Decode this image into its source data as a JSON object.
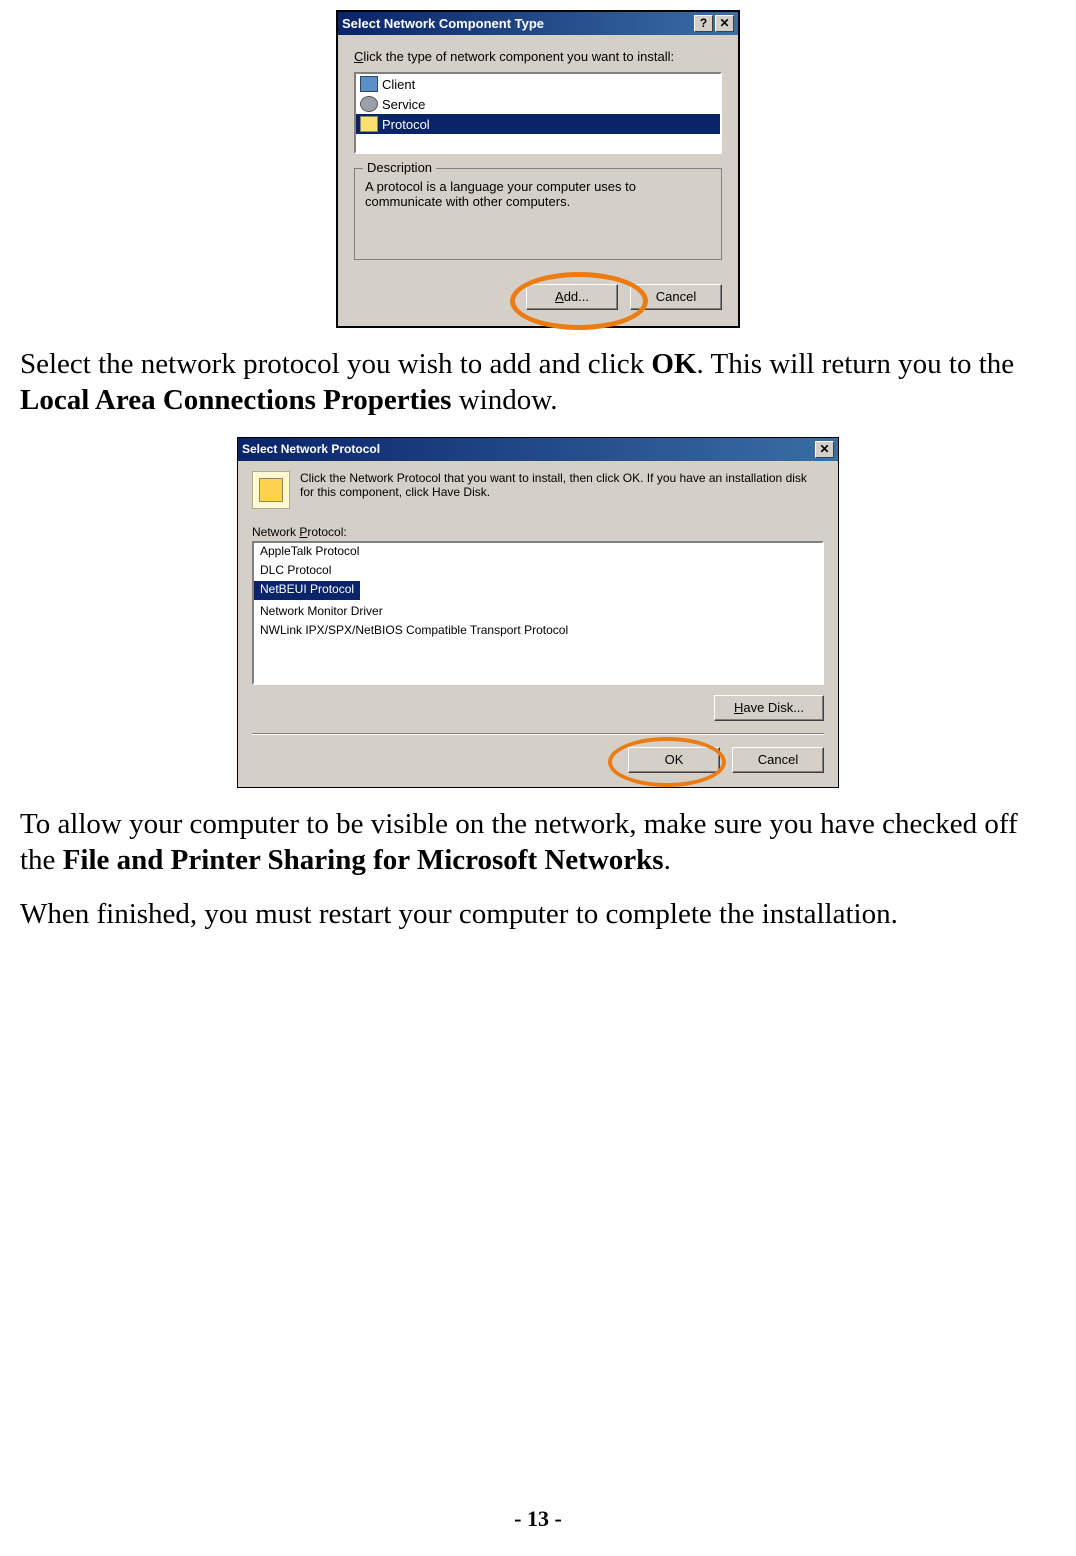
{
  "dialog1": {
    "title": "Select Network Component Type",
    "prompt_pre": "C",
    "prompt_post": "lick the type of network component you want to install:",
    "items": [
      "Client",
      "Service",
      "Protocol"
    ],
    "selected_index": 2,
    "group_label": "Description",
    "description": "A protocol is a language your computer uses to communicate with other computers.",
    "add_label_u": "A",
    "add_label_rest": "dd...",
    "cancel_label": "Cancel",
    "help_btn": "?",
    "close_btn": "✕"
  },
  "para1": {
    "a": "Select the network protocol you wish to add and click ",
    "b": "OK",
    "c": ". This will return you to the ",
    "d": "Local Area Connections Properties",
    "e": " window."
  },
  "dialog2": {
    "title": "Select Network Protocol",
    "close_btn": "✕",
    "intro": "Click the Network Protocol that you want to install, then click OK. If you have an installation disk for this component, click Have Disk.",
    "list_label_pre": "Network ",
    "list_label_u": "P",
    "list_label_post": "rotocol:",
    "items": [
      "AppleTalk Protocol",
      "DLC Protocol",
      "NetBEUI Protocol",
      "Network Monitor Driver",
      "NWLink IPX/SPX/NetBIOS Compatible Transport Protocol"
    ],
    "selected_index": 2,
    "have_disk_u": "H",
    "have_disk_rest": "ave Disk...",
    "ok_label": "OK",
    "cancel_label": "Cancel"
  },
  "para2": {
    "a": "To allow your computer to be visible on the network, make sure you have checked off the ",
    "b": "File and Printer Sharing for Microsoft Networks",
    "c": "."
  },
  "para3": "When finished, you must restart your computer to complete the installation.",
  "page_number": "- 13 -"
}
